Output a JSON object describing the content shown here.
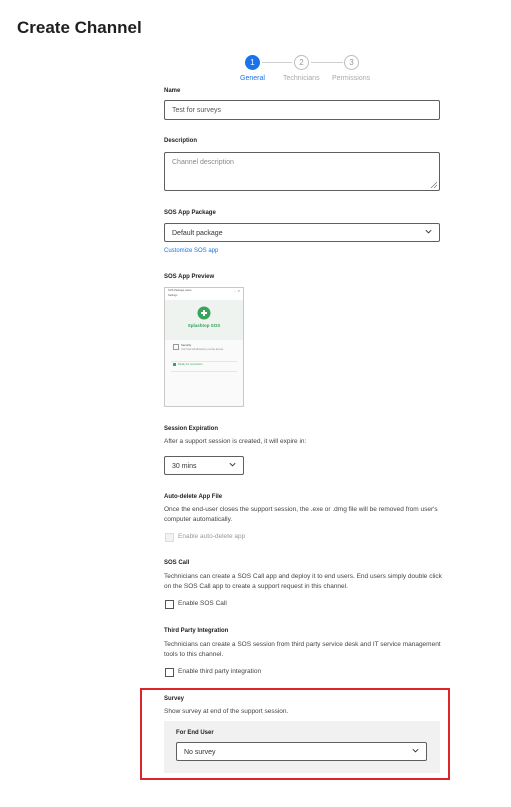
{
  "page": {
    "title": "Create Channel"
  },
  "stepper": {
    "steps": [
      {
        "number": "1",
        "label": "General",
        "active": true
      },
      {
        "number": "2",
        "label": "Technicians",
        "active": false
      },
      {
        "number": "3",
        "label": "Permissions",
        "active": false
      }
    ]
  },
  "name": {
    "label": "Name",
    "value": "Test for surveys"
  },
  "description": {
    "label": "Description",
    "placeholder": "Channel description"
  },
  "sos_app_package": {
    "label": "SOS App Package",
    "value": "Default package",
    "customize_link": "Customize SOS app"
  },
  "sos_app_preview": {
    "label": "SOS App Preview",
    "window_title": "SOS Package name",
    "menu": "Settings",
    "brand": "Splashtop SOS",
    "security_title": "Security",
    "security_text": "Your host will allow/deny remote access",
    "status": "Ready for connection"
  },
  "session_expiration": {
    "label": "Session Expiration",
    "description": "After a support session is created, it will expire in:",
    "value": "30 mins"
  },
  "auto_delete": {
    "label": "Auto-delete App File",
    "description": "Once the end-user closes the support session, the .exe or .dmg file will be removed from user's computer automatically.",
    "checkbox_label": "Enable auto-delete app"
  },
  "sos_call": {
    "label": "SOS Call",
    "description": "Technicians can create a SOS Call app and deploy it to end users. End users simply double click on the SOS Call app to create a support request in this channel.",
    "checkbox_label": "Enable SOS Call"
  },
  "third_party": {
    "label": "Third Party Integration",
    "description": "Technicians can create a SOS session from third party service desk and IT service management tools to this channel.",
    "checkbox_label": "Enable third party integration"
  },
  "survey": {
    "label": "Survey",
    "description": "Show survey at end of the support session.",
    "for_end_user_label": "For End User",
    "value": "No survey"
  },
  "colors": {
    "accent": "#1a73e8",
    "highlight": "#d9252c",
    "brand_green": "#3aa35c"
  }
}
